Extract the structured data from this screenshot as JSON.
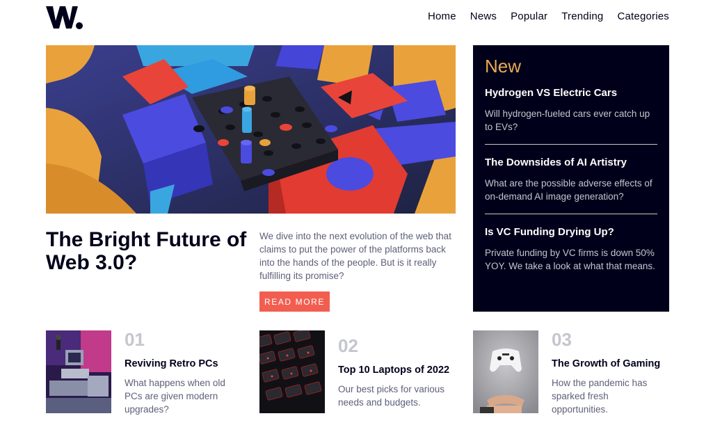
{
  "brand": {
    "logo_text": "W."
  },
  "nav": [
    "Home",
    "News",
    "Popular",
    "Trending",
    "Categories"
  ],
  "hero": {
    "title": "The Bright Future of Web 3.0?",
    "description": "We dive into the next evolution of the web that claims to put the power of the platforms back into the hands of the people. But is it really fulfilling its promise?",
    "button_label": "READ MORE"
  },
  "new_panel": {
    "heading": "New",
    "items": [
      {
        "title": "Hydrogen VS Electric Cars",
        "description": "Will hydrogen-fueled cars ever catch up to EVs?"
      },
      {
        "title": "The Downsides of AI Artistry",
        "description": "What are the possible adverse effects of on-demand AI image generation?"
      },
      {
        "title": "Is VC Funding Drying Up?",
        "description": "Private funding by VC firms is down 50% YOY. We take a look at what that means."
      }
    ]
  },
  "cards": [
    {
      "number": "01",
      "title": "Reviving Retro PCs",
      "description": "What happens when old PCs are given modern upgrades?"
    },
    {
      "number": "02",
      "title": "Top 10 Laptops of 2022",
      "description": "Our best picks for various needs and budgets."
    },
    {
      "number": "03",
      "title": "The Growth of Gaming",
      "description": "How the pandemic has sparked fresh opportunities."
    }
  ],
  "colors": {
    "dark_blue": "#00001a",
    "soft_orange": "#e9ab53",
    "soft_red": "#f15e50",
    "grayish_blue": "#c5c6ce",
    "dark_grayish_blue": "#5d5f79"
  }
}
